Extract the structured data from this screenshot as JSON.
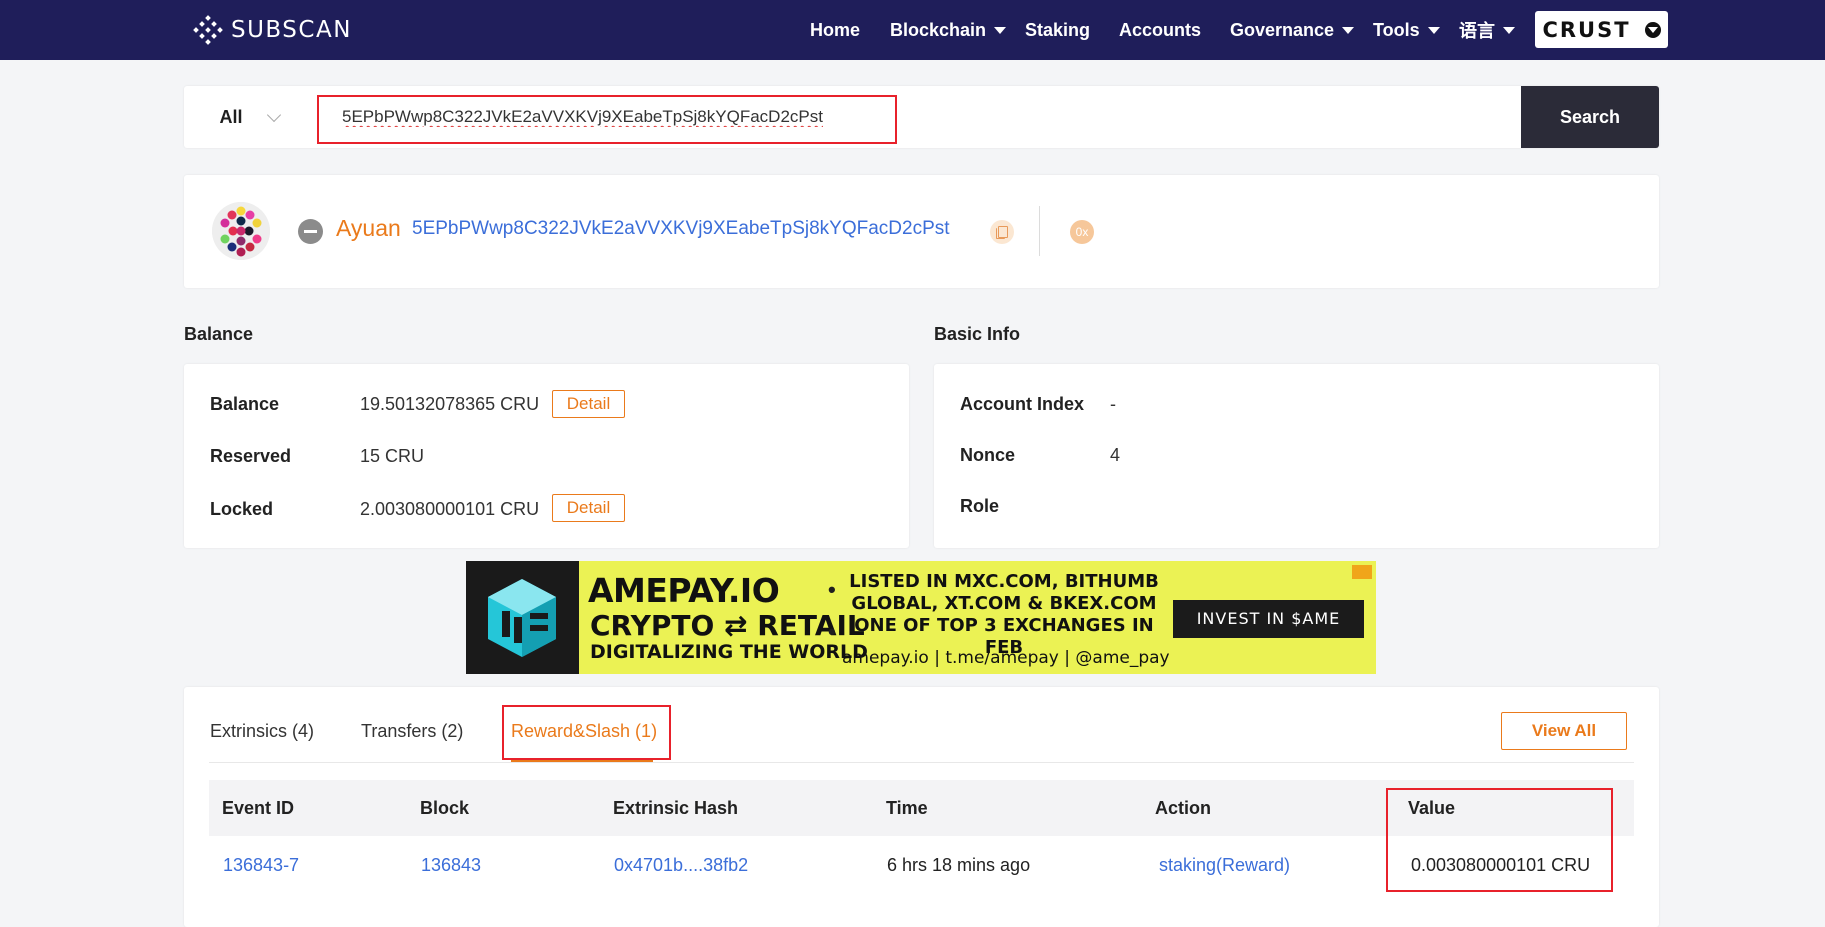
{
  "brand": {
    "name": "SUBSCAN"
  },
  "nav": {
    "items": [
      {
        "label": "Home"
      },
      {
        "label": "Blockchain"
      },
      {
        "label": "Staking"
      },
      {
        "label": "Accounts"
      },
      {
        "label": "Governance"
      },
      {
        "label": "Tools"
      },
      {
        "label": "语言"
      }
    ],
    "network": "CRUST"
  },
  "search": {
    "type": "All",
    "value": "5EPbPWwp8C322JVkE2aVVXKVj9XEabeTpSj8kYQFacD2cPst",
    "button": "Search"
  },
  "account": {
    "name": "Ayuan",
    "address": "5EPbPWwp8C322JVkE2aVVXKVj9XEabeTpSj8kYQFacD2cPst",
    "hex_label": "0x"
  },
  "balance": {
    "title": "Balance",
    "rows": [
      {
        "label": "Balance",
        "value": "19.50132078365 CRU",
        "action": "Detail"
      },
      {
        "label": "Reserved",
        "value": "15 CRU"
      },
      {
        "label": "Locked",
        "value": "2.003080000101 CRU",
        "action": "Detail"
      }
    ]
  },
  "basic_info": {
    "title": "Basic Info",
    "rows": [
      {
        "label": "Account Index",
        "value": "-"
      },
      {
        "label": "Nonce",
        "value": "4"
      },
      {
        "label": "Role",
        "value": ""
      }
    ]
  },
  "ad": {
    "title": "AMEPAY.IO",
    "subtitle": "CRYPTO ⇄ RETAIL",
    "tagline": "DIGITALIZING THE WORLD",
    "listed_line1": "LISTED IN MXC.COM, BITHUMB",
    "listed_line2": "GLOBAL, XT.COM & BKEX.COM",
    "listed_line3": "ONE OF TOP 3 EXCHANGES IN FEB",
    "links": "amepay.io | t.me/amepay | @ame_pay",
    "cta": "INVEST IN $AME",
    "brand_color": "#ebf254"
  },
  "tabs": {
    "items": [
      {
        "label": "Extrinsics (4)"
      },
      {
        "label": "Transfers (2)"
      },
      {
        "label": "Reward&Slash (1)"
      }
    ],
    "active": "Reward&Slash (1)",
    "view_all": "View All"
  },
  "table": {
    "columns": [
      "Event ID",
      "Block",
      "Extrinsic Hash",
      "Time",
      "Action",
      "Value"
    ],
    "rows": [
      {
        "event_id": "136843-7",
        "block": "136843",
        "extrinsic_hash": "0x4701b....38fb2",
        "time": "6 hrs 18 mins ago",
        "action": "staking(Reward)",
        "value": "0.003080000101 CRU"
      }
    ]
  },
  "colors": {
    "nav_bg": "#1f1e5a",
    "accent": "#ea7a1b",
    "link": "#3b6ed9",
    "highlight": "#e8212b"
  }
}
